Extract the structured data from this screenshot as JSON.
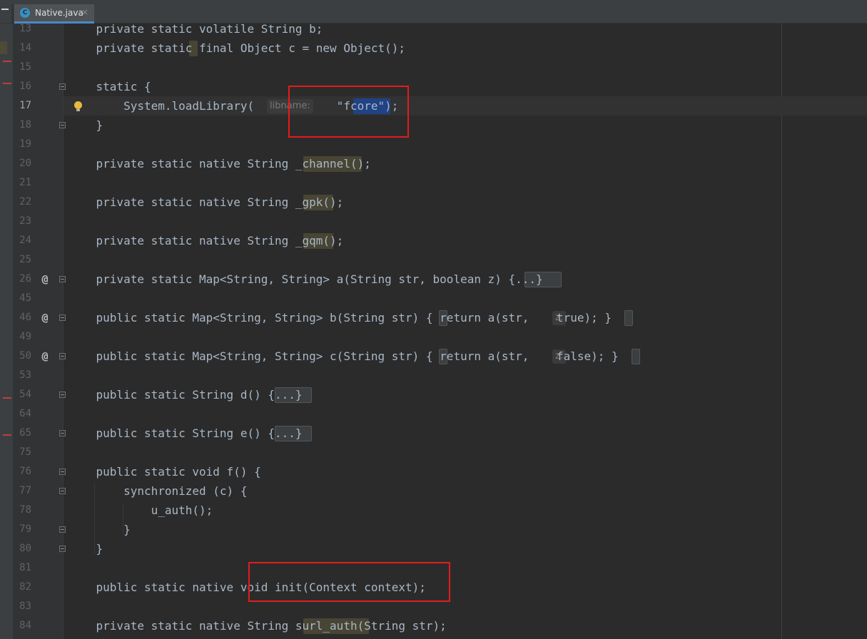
{
  "tab": {
    "file_name": "Native.java",
    "icon_letter": "C",
    "close_label": "×"
  },
  "colors": {
    "background": "#2b2b2b",
    "gutter": "#313335",
    "text": "#a9b7c6",
    "keyword": "#cc7832",
    "method": "#ffc66d",
    "string": "#6a8759",
    "field": "#9876aa",
    "annotation_box": "#e51b1b"
  },
  "icons": {
    "tab_icon": "java-class-icon",
    "override_marker": "at-sign-icon",
    "intention": "lightbulb-icon",
    "fold": "fold-toggle-icon"
  },
  "editor": {
    "current_line": 17,
    "lines": [
      {
        "n": 13,
        "text": "    private static volatile String b;"
      },
      {
        "n": 14,
        "text": "    private static final Object c = new Object();"
      },
      {
        "n": 15,
        "text": ""
      },
      {
        "n": 16,
        "text": "    static {"
      },
      {
        "n": 17,
        "text": "        System.loadLibrary(            \"fcore\");",
        "hint": "libname:"
      },
      {
        "n": 18,
        "text": "    }"
      },
      {
        "n": 19,
        "text": ""
      },
      {
        "n": 20,
        "text": "    private static native String _channel();"
      },
      {
        "n": 21,
        "text": ""
      },
      {
        "n": 22,
        "text": "    private static native String _gpk();"
      },
      {
        "n": 23,
        "text": ""
      },
      {
        "n": 24,
        "text": "    private static native String _gqm();"
      },
      {
        "n": 25,
        "text": ""
      },
      {
        "n": 26,
        "text": "    private static Map<String, String> a(String str, boolean z) {...}",
        "marker": "@"
      },
      {
        "n": 45,
        "text": ""
      },
      {
        "n": 46,
        "text": "    public static Map<String, String> b(String str) { return a(str,    true); }",
        "marker": "@",
        "hint": "z:"
      },
      {
        "n": 49,
        "text": ""
      },
      {
        "n": 50,
        "text": "    public static Map<String, String> c(String str) { return a(str,    false); }",
        "marker": "@",
        "hint": "z:"
      },
      {
        "n": 53,
        "text": ""
      },
      {
        "n": 54,
        "text": "    public static String d() {...}"
      },
      {
        "n": 64,
        "text": ""
      },
      {
        "n": 65,
        "text": "    public static String e() {...}"
      },
      {
        "n": 75,
        "text": ""
      },
      {
        "n": 76,
        "text": "    public static void f() {"
      },
      {
        "n": 77,
        "text": "        synchronized (c) {"
      },
      {
        "n": 78,
        "text": "            u_auth();"
      },
      {
        "n": 79,
        "text": "        }"
      },
      {
        "n": 80,
        "text": "    }"
      },
      {
        "n": 81,
        "text": ""
      },
      {
        "n": 82,
        "text": "    public static native void init(Context context);"
      },
      {
        "n": 83,
        "text": ""
      },
      {
        "n": 84,
        "text": "    private static native String surl_auth(String str);"
      }
    ]
  }
}
